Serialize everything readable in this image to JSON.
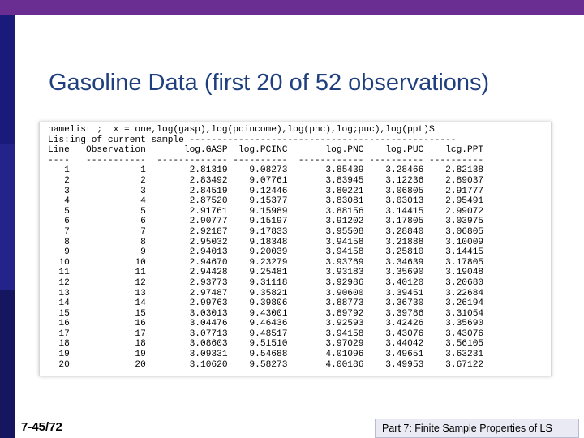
{
  "slide": {
    "title": "Gasoline Data (first 20 of 52 observations)",
    "number": "7-45/72",
    "footer": "Part 7: Finite Sample Properties of LS"
  },
  "output": {
    "namelist_line": "namelist ;| x = one,log(gasp),log(pcincome),log(pnc),log;puc),log(ppt)$",
    "listing_label": "Lis:ing of current sample",
    "columns": [
      "Line",
      "Observation",
      "log.GASP",
      "log.PCINC",
      "log.PNC",
      "log.PUC",
      "lcg.PPT"
    ],
    "rows": [
      [
        "1",
        "1",
        "2.81319",
        "9.08273",
        "3.85439",
        "3.28466",
        "2.82138"
      ],
      [
        "2",
        "2",
        "2.83492",
        "9.07761",
        "3.83945",
        "3.12236",
        "2.89037"
      ],
      [
        "3",
        "3",
        "2.84519",
        "9.12446",
        "3.80221",
        "3.06805",
        "2.91777"
      ],
      [
        "4",
        "4",
        "2.87520",
        "9.15377",
        "3.83081",
        "3.03013",
        "2.95491"
      ],
      [
        "5",
        "5",
        "2.91761",
        "9.15989",
        "3.88156",
        "3.14415",
        "2.99072"
      ],
      [
        "6",
        "6",
        "2.90777",
        "9.15197",
        "3.91202",
        "3.17805",
        "3.03975"
      ],
      [
        "7",
        "7",
        "2.92187",
        "9.17833",
        "3.95508",
        "3.28840",
        "3.06805"
      ],
      [
        "8",
        "8",
        "2.95032",
        "9.18348",
        "3.94158",
        "3.21888",
        "3.10009"
      ],
      [
        "9",
        "9",
        "2.94013",
        "9.20039",
        "3.94158",
        "3.25810",
        "3.14415"
      ],
      [
        "10",
        "10",
        "2.94670",
        "9.23279",
        "3.93769",
        "3.34639",
        "3.17805"
      ],
      [
        "11",
        "11",
        "2.94428",
        "9.25481",
        "3.93183",
        "3.35690",
        "3.19048"
      ],
      [
        "12",
        "12",
        "2.93773",
        "9.31118",
        "3.92986",
        "3.40120",
        "3.20680"
      ],
      [
        "13",
        "13",
        "2.97487",
        "9.35821",
        "3.90600",
        "3.39451",
        "3.22684"
      ],
      [
        "14",
        "14",
        "2.99763",
        "9.39806",
        "3.88773",
        "3.36730",
        "3.26194"
      ],
      [
        "15",
        "15",
        "3.03013",
        "9.43001",
        "3.89792",
        "3.39786",
        "3.31054"
      ],
      [
        "16",
        "16",
        "3.04476",
        "9.46436",
        "3.92593",
        "3.42426",
        "3.35690"
      ],
      [
        "17",
        "17",
        "3.07713",
        "9.48517",
        "3.94158",
        "3.43076",
        "3.43076"
      ],
      [
        "18",
        "18",
        "3.08603",
        "9.51510",
        "3.97029",
        "3.44042",
        "3.56105"
      ],
      [
        "19",
        "19",
        "3.09331",
        "9.54688",
        "4.01096",
        "3.49651",
        "3.63231"
      ],
      [
        "20",
        "20",
        "3.10620",
        "9.58273",
        "4.00186",
        "3.49953",
        "3.67122"
      ]
    ]
  }
}
